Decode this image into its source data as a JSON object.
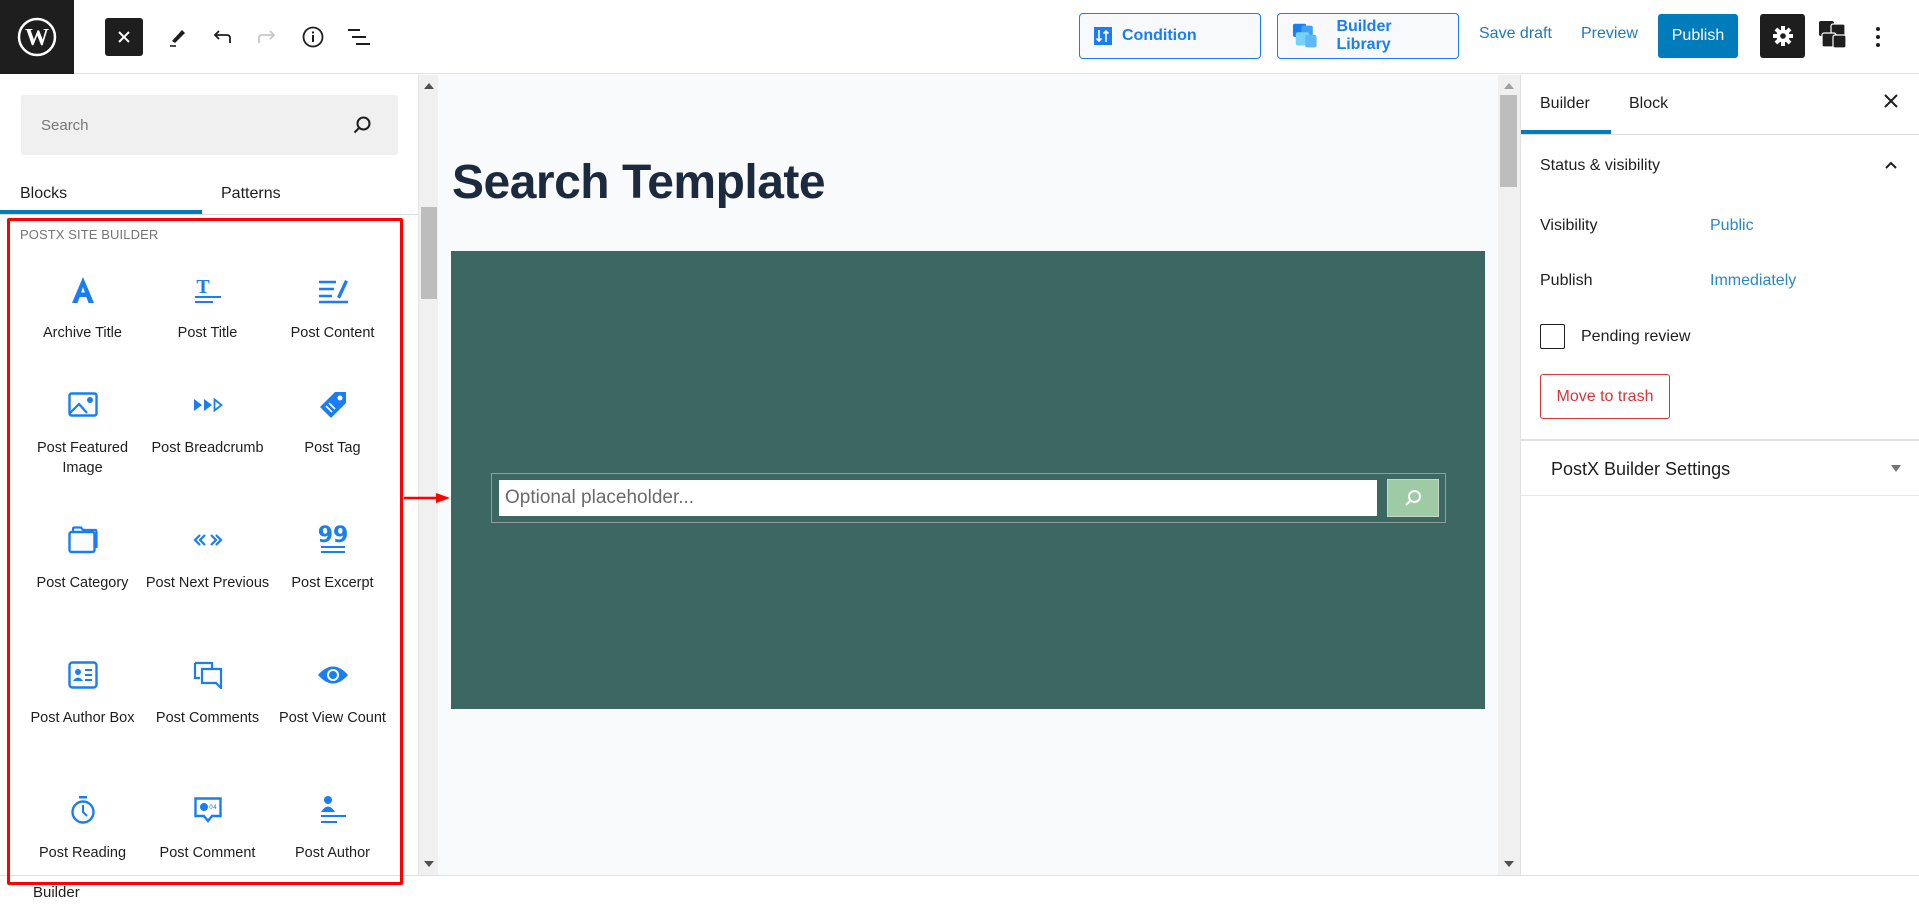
{
  "topbar": {
    "close_inserter_label": "Close block inserter",
    "condition_label": "Condition",
    "builder_library_label": "Builder Library",
    "save_draft_label": "Save draft",
    "preview_label": "Preview",
    "publish_label": "Publish"
  },
  "inserter": {
    "search_placeholder": "Search",
    "tabs": [
      {
        "label": "Blocks",
        "active": true
      },
      {
        "label": "Patterns",
        "active": false
      }
    ],
    "category_title": "POSTX SITE BUILDER",
    "blocks": [
      {
        "label": "Archive Title",
        "icon": "archive-title-icon"
      },
      {
        "label": "Post Title",
        "icon": "post-title-icon"
      },
      {
        "label": "Post Content",
        "icon": "post-content-icon"
      },
      {
        "label": "Post Featured Image",
        "icon": "image-icon"
      },
      {
        "label": "Post Breadcrumb",
        "icon": "breadcrumb-icon"
      },
      {
        "label": "Post Tag",
        "icon": "tag-icon"
      },
      {
        "label": "Post Category",
        "icon": "folder-icon"
      },
      {
        "label": "Post Next Previous",
        "icon": "next-previous-icon"
      },
      {
        "label": "Post Excerpt",
        "icon": "quote-icon"
      },
      {
        "label": "Post Author Box",
        "icon": "author-card-icon"
      },
      {
        "label": "Post Comments",
        "icon": "comments-icon"
      },
      {
        "label": "Post View Count",
        "icon": "eye-icon"
      },
      {
        "label": "Post Reading",
        "icon": "stopwatch-icon"
      },
      {
        "label": "Post Comment",
        "icon": "comment-count-icon"
      },
      {
        "label": "Post Author",
        "icon": "author-icon"
      }
    ]
  },
  "canvas": {
    "page_title": "Search Template",
    "search_placeholder": "Optional placeholder...",
    "block_bg_color": "#3c6762",
    "search_button_color": "#9ecaa6"
  },
  "sidebar": {
    "tabs": [
      {
        "label": "Builder",
        "active": true
      },
      {
        "label": "Block",
        "active": false
      }
    ],
    "status_section_title": "Status & visibility",
    "visibility_label": "Visibility",
    "visibility_value": "Public",
    "publish_label": "Publish",
    "publish_value": "Immediately",
    "pending_review_label": "Pending review",
    "pending_review_checked": false,
    "move_to_trash_label": "Move to trash",
    "postx_settings_title": "PostX Builder Settings"
  },
  "footer": {
    "breadcrumb": "Builder"
  },
  "colors": {
    "accent": "#007cba",
    "postx_blue": "#1a7ef2",
    "danger": "#d63638",
    "annotation_red": "#ff0000"
  }
}
